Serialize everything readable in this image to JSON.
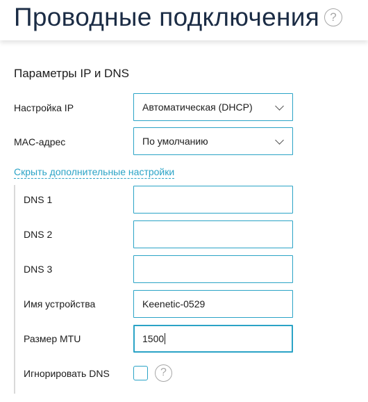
{
  "header": {
    "title": "Проводные подключения",
    "help_glyph": "?"
  },
  "section": {
    "title": "Параметры IP и DNS"
  },
  "ip_setting": {
    "label": "Настройка IP",
    "value": "Автоматическая (DHCP)"
  },
  "mac": {
    "label": "MAC-адрес",
    "value": "По умолчанию"
  },
  "toggle_link": "Скрыть дополнительные настройки",
  "fields": {
    "dns1": {
      "label": "DNS 1",
      "value": ""
    },
    "dns2": {
      "label": "DNS 2",
      "value": ""
    },
    "dns3": {
      "label": "DNS 3",
      "value": ""
    },
    "device_name": {
      "label": "Имя устройства",
      "value": "Keenetic-0529"
    },
    "mtu": {
      "label": "Размер MTU",
      "value": "1500"
    }
  },
  "ignore_dns": {
    "label": "Игнорировать DNS",
    "checked": false,
    "help_glyph": "?"
  },
  "colors": {
    "accent": "#2aa3c6",
    "title": "#1b2c45",
    "help": "#a7a7a7"
  }
}
